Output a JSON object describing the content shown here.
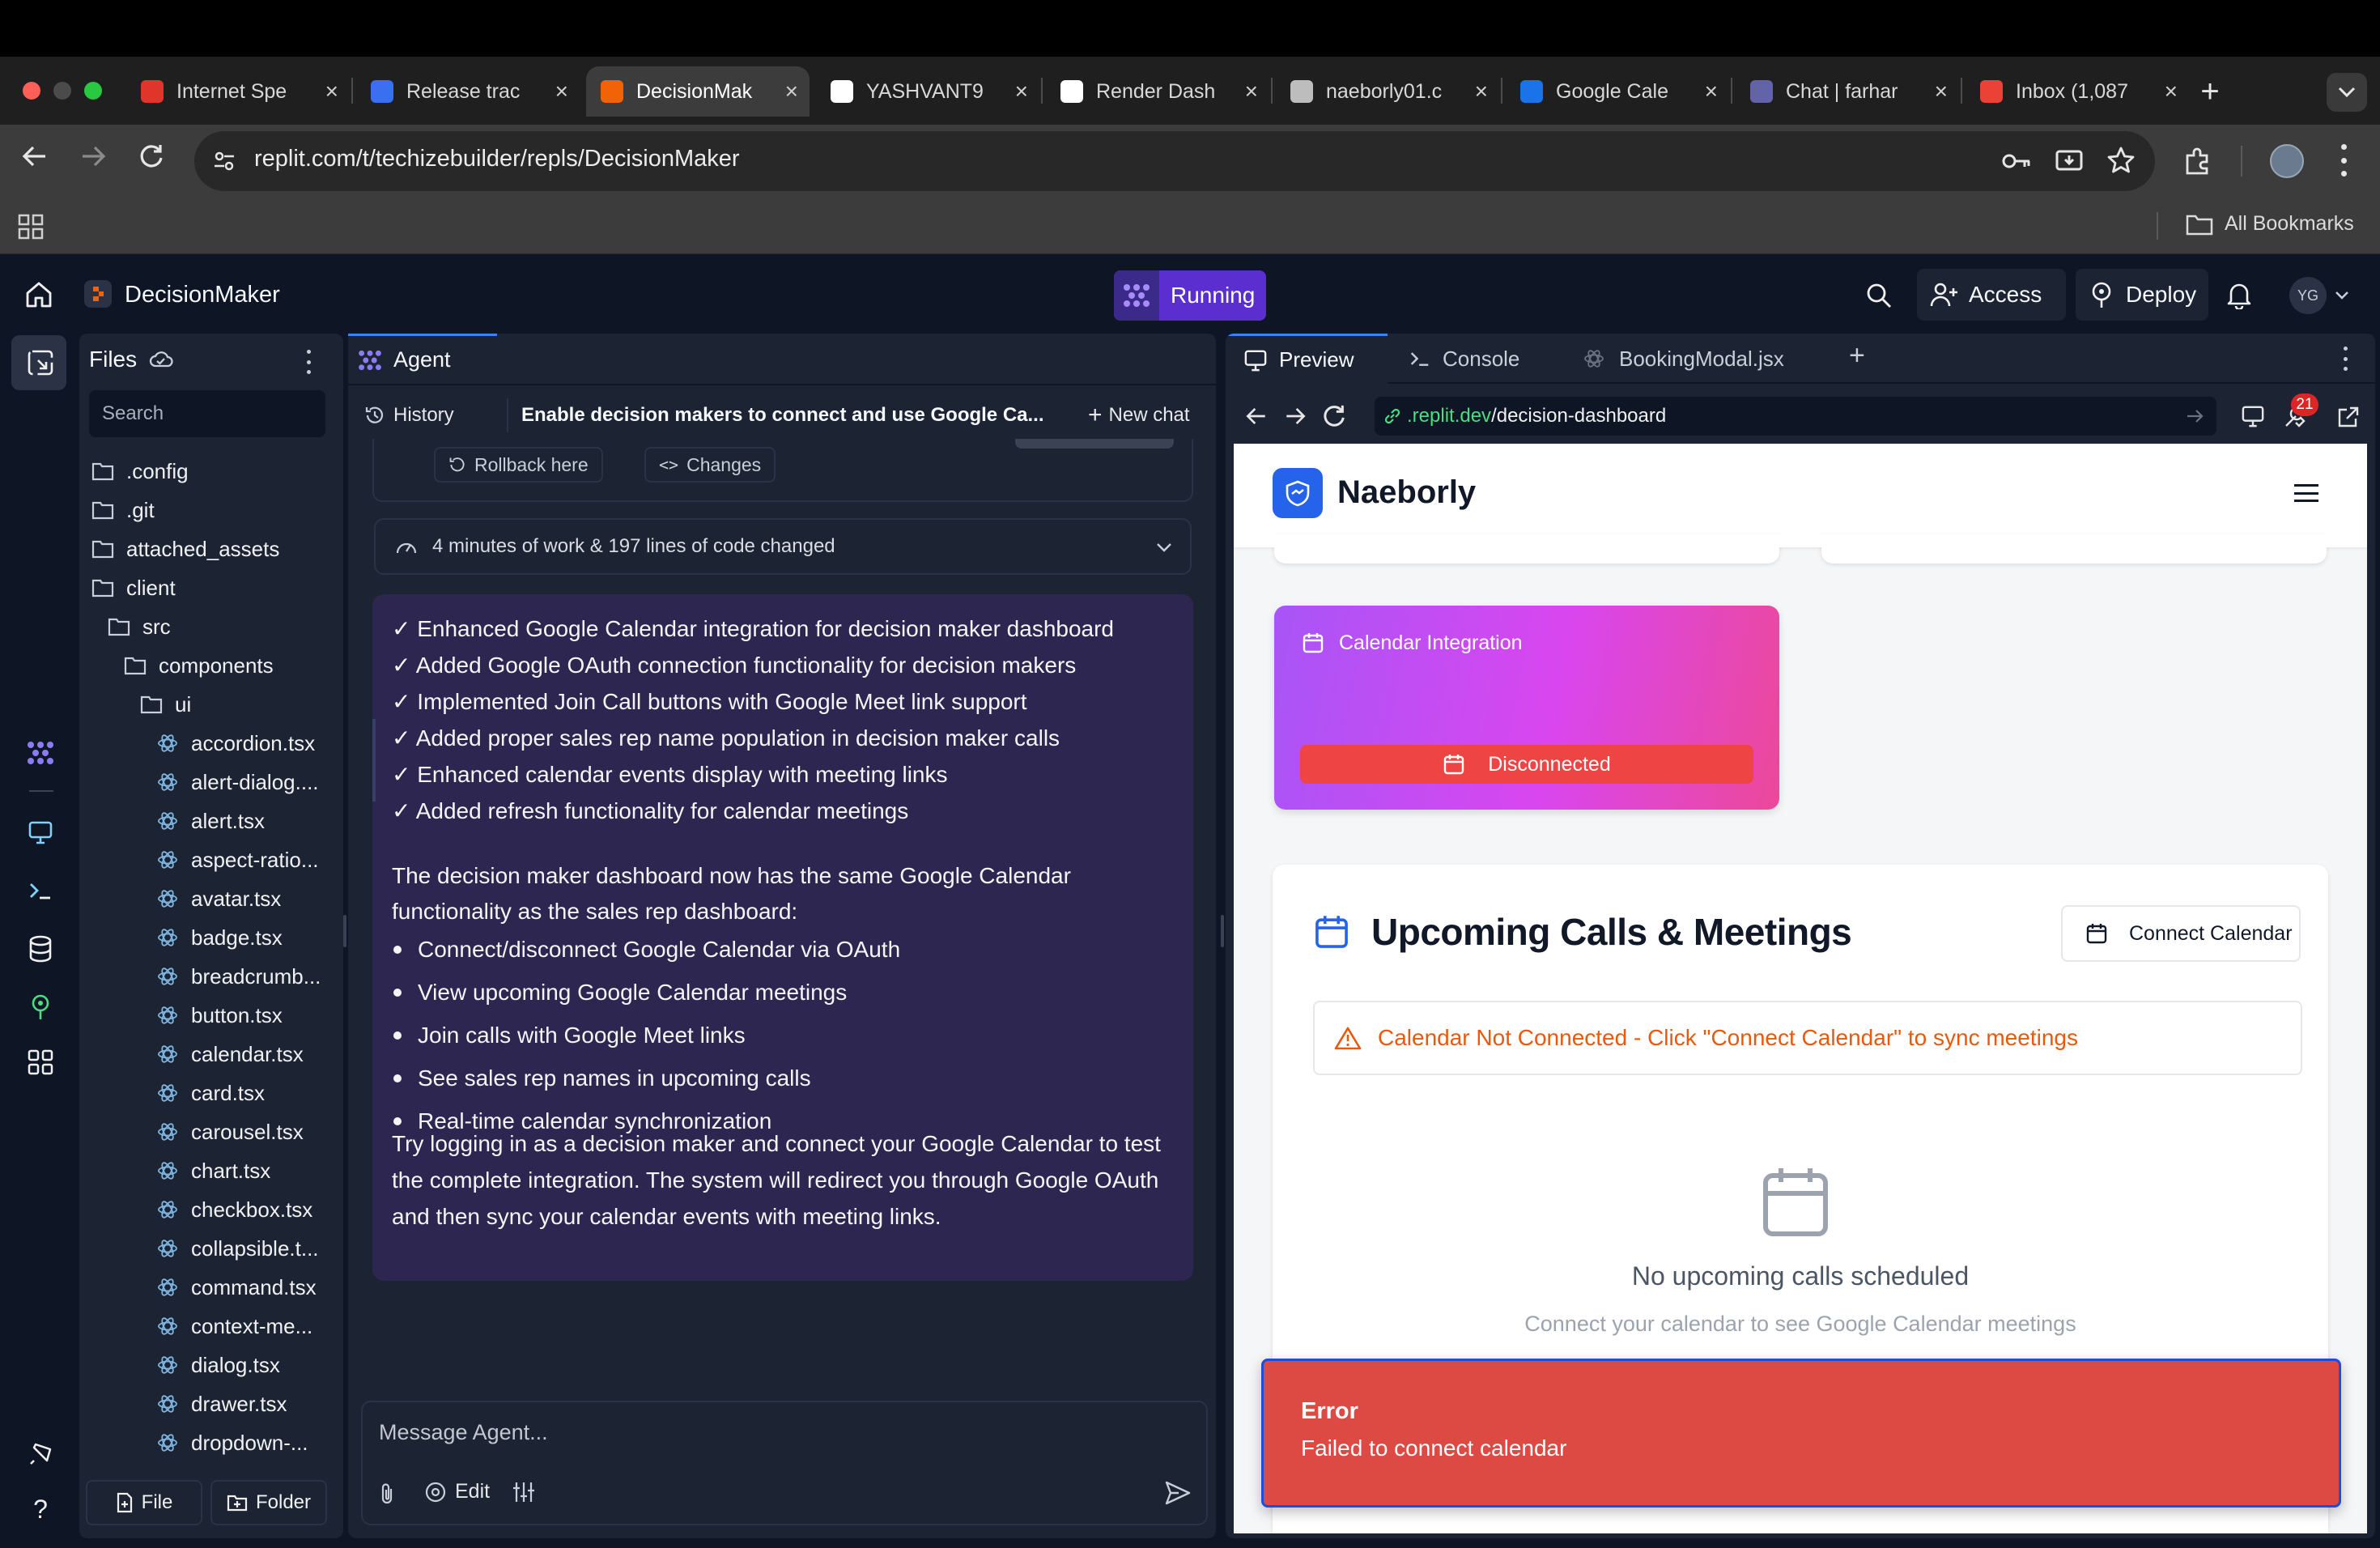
{
  "browser": {
    "tabs": [
      {
        "title": "Internet Spe",
        "favicon": "gauge-icon",
        "color": "#e0352b"
      },
      {
        "title": "Release trac",
        "favicon": "plane-icon",
        "color": "#3b6ff2"
      },
      {
        "title": "DecisionMak",
        "favicon": "replit-icon",
        "color": "#f26207",
        "active": true
      },
      {
        "title": "YASHVANT9",
        "favicon": "github-icon",
        "color": "#ffffff"
      },
      {
        "title": "Render Dash",
        "favicon": "render-icon",
        "color": "#ffffff"
      },
      {
        "title": "naeborly01.c",
        "favicon": "globe-icon",
        "color": "#bdbdbd"
      },
      {
        "title": "Google Cale",
        "favicon": "calendar-icon",
        "color": "#1a73e8"
      },
      {
        "title": "Chat | farhar",
        "favicon": "teams-icon",
        "color": "#6264a7"
      },
      {
        "title": "Inbox (1,087",
        "favicon": "gmail-icon",
        "color": "#ea4335"
      }
    ],
    "url": "replit.com/t/techizebuilder/repls/DecisionMaker",
    "all_bookmarks_label": "All Bookmarks"
  },
  "replit": {
    "repl_name": "DecisionMaker",
    "run_status": "Running",
    "access_label": "Access",
    "deploy_label": "Deploy",
    "avatar_initials": "YG"
  },
  "files": {
    "title": "Files",
    "search_placeholder": "Search",
    "tree": [
      {
        "name": ".config",
        "type": "folder",
        "depth": 0
      },
      {
        "name": ".git",
        "type": "folder",
        "depth": 0
      },
      {
        "name": "attached_assets",
        "type": "folder",
        "depth": 0
      },
      {
        "name": "client",
        "type": "folder",
        "depth": 0
      },
      {
        "name": "src",
        "type": "folder",
        "depth": 1
      },
      {
        "name": "components",
        "type": "folder",
        "depth": 2
      },
      {
        "name": "ui",
        "type": "folder",
        "depth": 3
      },
      {
        "name": "accordion.tsx",
        "type": "react",
        "depth": 4
      },
      {
        "name": "alert-dialog....",
        "type": "react",
        "depth": 4
      },
      {
        "name": "alert.tsx",
        "type": "react",
        "depth": 4
      },
      {
        "name": "aspect-ratio...",
        "type": "react",
        "depth": 4
      },
      {
        "name": "avatar.tsx",
        "type": "react",
        "depth": 4
      },
      {
        "name": "badge.tsx",
        "type": "react",
        "depth": 4
      },
      {
        "name": "breadcrumb...",
        "type": "react",
        "depth": 4
      },
      {
        "name": "button.tsx",
        "type": "react",
        "depth": 4
      },
      {
        "name": "calendar.tsx",
        "type": "react",
        "depth": 4
      },
      {
        "name": "card.tsx",
        "type": "react",
        "depth": 4
      },
      {
        "name": "carousel.tsx",
        "type": "react",
        "depth": 4
      },
      {
        "name": "chart.tsx",
        "type": "react",
        "depth": 4
      },
      {
        "name": "checkbox.tsx",
        "type": "react",
        "depth": 4
      },
      {
        "name": "collapsible.t...",
        "type": "react",
        "depth": 4
      },
      {
        "name": "command.tsx",
        "type": "react",
        "depth": 4
      },
      {
        "name": "context-me...",
        "type": "react",
        "depth": 4
      },
      {
        "name": "dialog.tsx",
        "type": "react",
        "depth": 4
      },
      {
        "name": "drawer.tsx",
        "type": "react",
        "depth": 4
      },
      {
        "name": "dropdown-...",
        "type": "react",
        "depth": 4
      }
    ],
    "new_file_label": "File",
    "new_folder_label": "Folder"
  },
  "agent": {
    "tab_label": "Agent",
    "history_label": "History",
    "chat_title": "Enable decision makers to connect and use Google Ca...",
    "new_chat_label": "New chat",
    "rollback_label": "Rollback here",
    "changes_label": "Changes",
    "work_summary": "4 minutes of work & 197 lines of code changed",
    "checklist": [
      "✓ Enhanced Google Calendar integration for decision maker dashboard",
      "✓ Added Google OAuth connection functionality for decision makers",
      "✓ Implemented Join Call buttons with Google Meet link support",
      "✓ Added proper sales rep name population in decision maker calls",
      "✓ Enhanced calendar events display with meeting links",
      "✓ Added refresh functionality for calendar meetings"
    ],
    "para1_line1": "The decision maker dashboard now has the same Google Calendar",
    "para1_line2": "functionality as the sales rep dashboard:",
    "bullets": [
      "Connect/disconnect Google Calendar via OAuth",
      "View upcoming Google Calendar meetings",
      "Join calls with Google Meet links",
      "See sales rep names in upcoming calls",
      "Real-time calendar synchronization"
    ],
    "para2_line1": "Try logging in as a decision maker and connect your Google Calendar to test",
    "para2_line2": "the complete integration. The system will redirect you through Google OAuth",
    "para2_line3": "and then sync your calendar events with meeting links.",
    "message_placeholder": "Message Agent...",
    "edit_label": "Edit"
  },
  "preview": {
    "tabs": [
      "Preview",
      "Console",
      "BookingModal.jsx"
    ],
    "url_domain": ".replit.dev",
    "url_path": "/decision-dashboard",
    "badge_count": "21"
  },
  "app": {
    "brand": "Naeborly",
    "calendar_card_title": "Calendar Integration",
    "calendar_status": "Disconnected",
    "meetings_title": "Upcoming Calls & Meetings",
    "connect_button": "Connect Calendar",
    "warning": "Calendar Not Connected - Click \"Connect Calendar\" to sync meetings",
    "empty_title": "No upcoming calls scheduled",
    "empty_subtitle": "Connect your calendar to see Google Calendar meetings",
    "toast_title": "Error",
    "toast_message": "Failed to connect calendar"
  },
  "colors": {
    "replit_bg": "#0e1525",
    "panel_bg": "#1c2333",
    "agent_message_bg": "#2c2650",
    "running": "#6d3bd9",
    "brand_blue": "#2563eb",
    "gradient_start": "#a855f7",
    "gradient_end": "#ec4899",
    "disconnected_red": "#ef4444",
    "warning_orange": "#ea580c",
    "toast_red": "#dc4a43"
  }
}
